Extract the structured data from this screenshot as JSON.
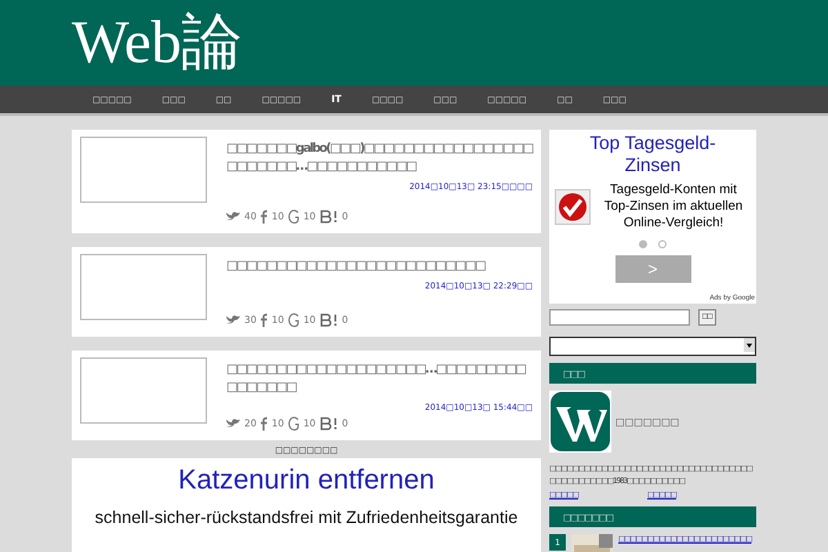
{
  "site_title": "Web論",
  "nav": [
    {
      "label": "□□□□□",
      "selected": false
    },
    {
      "label": "□□□",
      "selected": false
    },
    {
      "label": "□□",
      "selected": false
    },
    {
      "label": "□□□□□",
      "selected": false
    },
    {
      "label": "IT",
      "selected": true
    },
    {
      "label": "□□□□",
      "selected": false
    },
    {
      "label": "□□□",
      "selected": false
    },
    {
      "label": "□□□□□",
      "selected": false
    },
    {
      "label": "□□",
      "selected": false
    },
    {
      "label": "□□□",
      "selected": false
    }
  ],
  "posts": [
    {
      "title": "□□□□□□□galbo(□□□)□□□□□□□□□□□□□□□□□□□□□□□□…□□□□□□□□□□□",
      "date": "2014□10□13□ 23:15□□□□",
      "tweets": "40",
      "likes": "10",
      "plus": "10",
      "hatena": "0"
    },
    {
      "title": "□□□□□□□□□□□□□□□□□□□□□□□□□□",
      "date": "2014□10□13□ 22:29□□",
      "tweets": "30",
      "likes": "10",
      "plus": "10",
      "hatena": "0"
    },
    {
      "title": "□□□□□□□□□□□□□□□□□□□□…□□□□□□□□□□□□□□□□",
      "date": "2014□10□13□ 15:44□□",
      "tweets": "20",
      "likes": "10",
      "plus": "10",
      "hatena": "0"
    }
  ],
  "main_ad": {
    "label": "□□□□□□□□",
    "title": "Katzenurin entfernen",
    "text": "schnell-sicher-rückstandsfrei mit Zufriedenheitsgarantie"
  },
  "side_ad": {
    "title": "Top Tagesgeld-Zinsen",
    "text": "Tagesgeld-Konten mit Top-Zinsen im aktuellen Online-Vergleich!",
    "pages": [
      {
        "selected": true
      },
      {
        "selected": false
      }
    ],
    "next": ">",
    "attribution": "Ads by Google"
  },
  "search": {
    "button": "□□"
  },
  "profile": {
    "heading": "□□□",
    "name": "□□□□□□□",
    "bio": "□□□□□□□□□□□□□□□□□□□□□□□□□□□□□□□□□□□□□□□□□□□□□□1983□□□□□□□□□□",
    "links": [
      "□□□□□",
      "□□□□□"
    ]
  },
  "ranking": {
    "heading": "□□□□□□□",
    "items": [
      {
        "rank": "1",
        "title": "□□□□□□□□□□□□□□□□□□□□□□□"
      }
    ]
  }
}
